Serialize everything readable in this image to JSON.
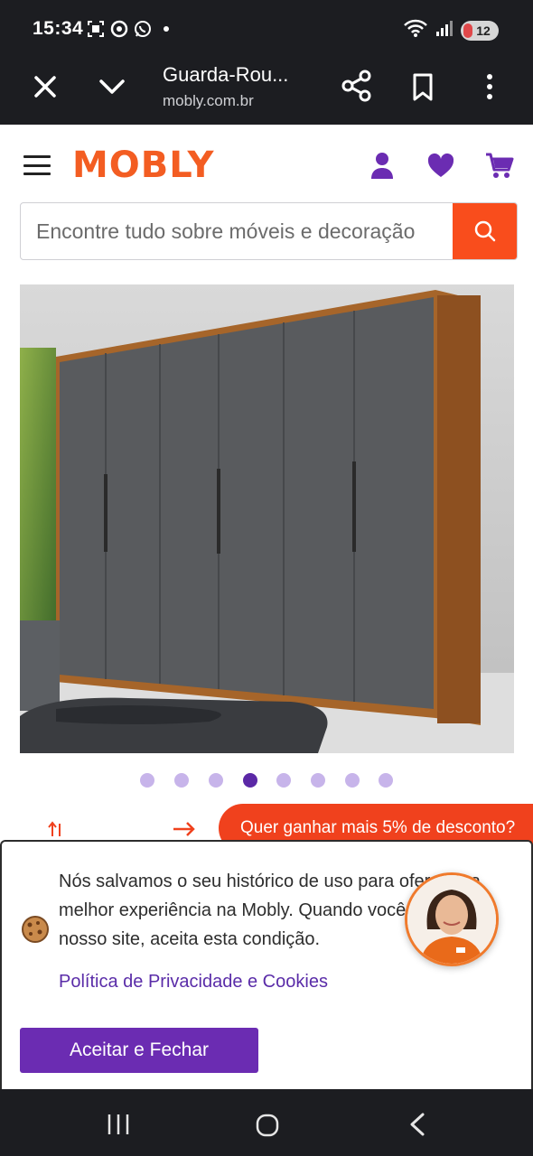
{
  "status_bar": {
    "time": "15:34",
    "battery": "12",
    "left_icons": [
      "screenshot-icon",
      "chrome-icon",
      "whatsapp-icon",
      "dot-icon"
    ],
    "right_icons": [
      "wifi-icon",
      "signal-icon",
      "battery-icon"
    ]
  },
  "browser": {
    "title": "Guarda-Rou...",
    "domain": "mobly.com.br"
  },
  "header": {
    "logo": "MOBLY",
    "brand_color": "#f35d22",
    "accent_color": "#6b2cb2"
  },
  "search": {
    "placeholder": "Encontre tudo sobre móveis e decoração"
  },
  "carousel": {
    "total": 8,
    "active": 4
  },
  "promo": {
    "text": "Quer ganhar mais 5% de desconto?"
  },
  "cookie": {
    "text": "Nós salvamos o seu histórico de uso para oferecer a melhor experiência na Mobly. Quando você navega no nosso site, aceita esta condição.",
    "link": "Política de Privacidade e Cookies",
    "accept": "Aceitar e Fechar"
  }
}
